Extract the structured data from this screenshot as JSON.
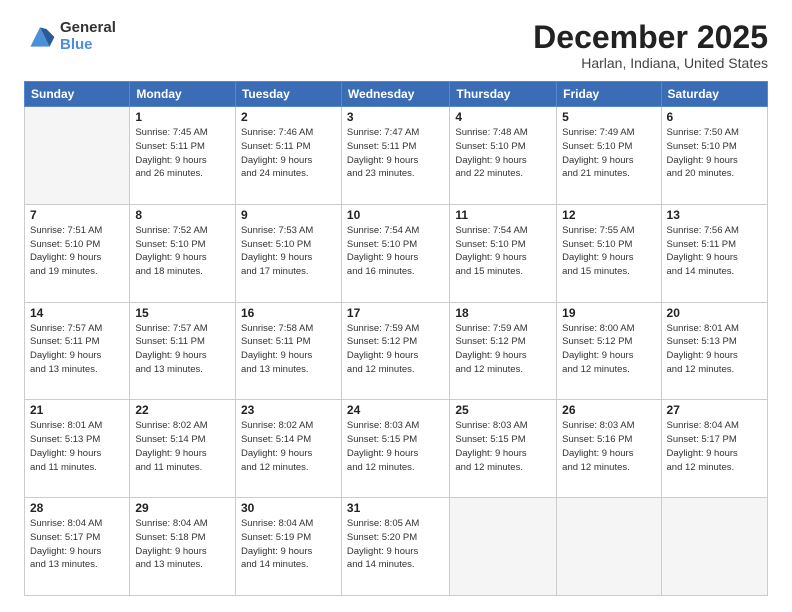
{
  "logo": {
    "general": "General",
    "blue": "Blue"
  },
  "header": {
    "month": "December 2025",
    "location": "Harlan, Indiana, United States"
  },
  "weekdays": [
    "Sunday",
    "Monday",
    "Tuesday",
    "Wednesday",
    "Thursday",
    "Friday",
    "Saturday"
  ],
  "weeks": [
    [
      {
        "day": "",
        "info": ""
      },
      {
        "day": "1",
        "info": "Sunrise: 7:45 AM\nSunset: 5:11 PM\nDaylight: 9 hours\nand 26 minutes."
      },
      {
        "day": "2",
        "info": "Sunrise: 7:46 AM\nSunset: 5:11 PM\nDaylight: 9 hours\nand 24 minutes."
      },
      {
        "day": "3",
        "info": "Sunrise: 7:47 AM\nSunset: 5:11 PM\nDaylight: 9 hours\nand 23 minutes."
      },
      {
        "day": "4",
        "info": "Sunrise: 7:48 AM\nSunset: 5:10 PM\nDaylight: 9 hours\nand 22 minutes."
      },
      {
        "day": "5",
        "info": "Sunrise: 7:49 AM\nSunset: 5:10 PM\nDaylight: 9 hours\nand 21 minutes."
      },
      {
        "day": "6",
        "info": "Sunrise: 7:50 AM\nSunset: 5:10 PM\nDaylight: 9 hours\nand 20 minutes."
      }
    ],
    [
      {
        "day": "7",
        "info": "Sunrise: 7:51 AM\nSunset: 5:10 PM\nDaylight: 9 hours\nand 19 minutes."
      },
      {
        "day": "8",
        "info": "Sunrise: 7:52 AM\nSunset: 5:10 PM\nDaylight: 9 hours\nand 18 minutes."
      },
      {
        "day": "9",
        "info": "Sunrise: 7:53 AM\nSunset: 5:10 PM\nDaylight: 9 hours\nand 17 minutes."
      },
      {
        "day": "10",
        "info": "Sunrise: 7:54 AM\nSunset: 5:10 PM\nDaylight: 9 hours\nand 16 minutes."
      },
      {
        "day": "11",
        "info": "Sunrise: 7:54 AM\nSunset: 5:10 PM\nDaylight: 9 hours\nand 15 minutes."
      },
      {
        "day": "12",
        "info": "Sunrise: 7:55 AM\nSunset: 5:10 PM\nDaylight: 9 hours\nand 15 minutes."
      },
      {
        "day": "13",
        "info": "Sunrise: 7:56 AM\nSunset: 5:11 PM\nDaylight: 9 hours\nand 14 minutes."
      }
    ],
    [
      {
        "day": "14",
        "info": "Sunrise: 7:57 AM\nSunset: 5:11 PM\nDaylight: 9 hours\nand 13 minutes."
      },
      {
        "day": "15",
        "info": "Sunrise: 7:57 AM\nSunset: 5:11 PM\nDaylight: 9 hours\nand 13 minutes."
      },
      {
        "day": "16",
        "info": "Sunrise: 7:58 AM\nSunset: 5:11 PM\nDaylight: 9 hours\nand 13 minutes."
      },
      {
        "day": "17",
        "info": "Sunrise: 7:59 AM\nSunset: 5:12 PM\nDaylight: 9 hours\nand 12 minutes."
      },
      {
        "day": "18",
        "info": "Sunrise: 7:59 AM\nSunset: 5:12 PM\nDaylight: 9 hours\nand 12 minutes."
      },
      {
        "day": "19",
        "info": "Sunrise: 8:00 AM\nSunset: 5:12 PM\nDaylight: 9 hours\nand 12 minutes."
      },
      {
        "day": "20",
        "info": "Sunrise: 8:01 AM\nSunset: 5:13 PM\nDaylight: 9 hours\nand 12 minutes."
      }
    ],
    [
      {
        "day": "21",
        "info": "Sunrise: 8:01 AM\nSunset: 5:13 PM\nDaylight: 9 hours\nand 11 minutes."
      },
      {
        "day": "22",
        "info": "Sunrise: 8:02 AM\nSunset: 5:14 PM\nDaylight: 9 hours\nand 11 minutes."
      },
      {
        "day": "23",
        "info": "Sunrise: 8:02 AM\nSunset: 5:14 PM\nDaylight: 9 hours\nand 12 minutes."
      },
      {
        "day": "24",
        "info": "Sunrise: 8:03 AM\nSunset: 5:15 PM\nDaylight: 9 hours\nand 12 minutes."
      },
      {
        "day": "25",
        "info": "Sunrise: 8:03 AM\nSunset: 5:15 PM\nDaylight: 9 hours\nand 12 minutes."
      },
      {
        "day": "26",
        "info": "Sunrise: 8:03 AM\nSunset: 5:16 PM\nDaylight: 9 hours\nand 12 minutes."
      },
      {
        "day": "27",
        "info": "Sunrise: 8:04 AM\nSunset: 5:17 PM\nDaylight: 9 hours\nand 12 minutes."
      }
    ],
    [
      {
        "day": "28",
        "info": "Sunrise: 8:04 AM\nSunset: 5:17 PM\nDaylight: 9 hours\nand 13 minutes."
      },
      {
        "day": "29",
        "info": "Sunrise: 8:04 AM\nSunset: 5:18 PM\nDaylight: 9 hours\nand 13 minutes."
      },
      {
        "day": "30",
        "info": "Sunrise: 8:04 AM\nSunset: 5:19 PM\nDaylight: 9 hours\nand 14 minutes."
      },
      {
        "day": "31",
        "info": "Sunrise: 8:05 AM\nSunset: 5:20 PM\nDaylight: 9 hours\nand 14 minutes."
      },
      {
        "day": "",
        "info": ""
      },
      {
        "day": "",
        "info": ""
      },
      {
        "day": "",
        "info": ""
      }
    ]
  ]
}
